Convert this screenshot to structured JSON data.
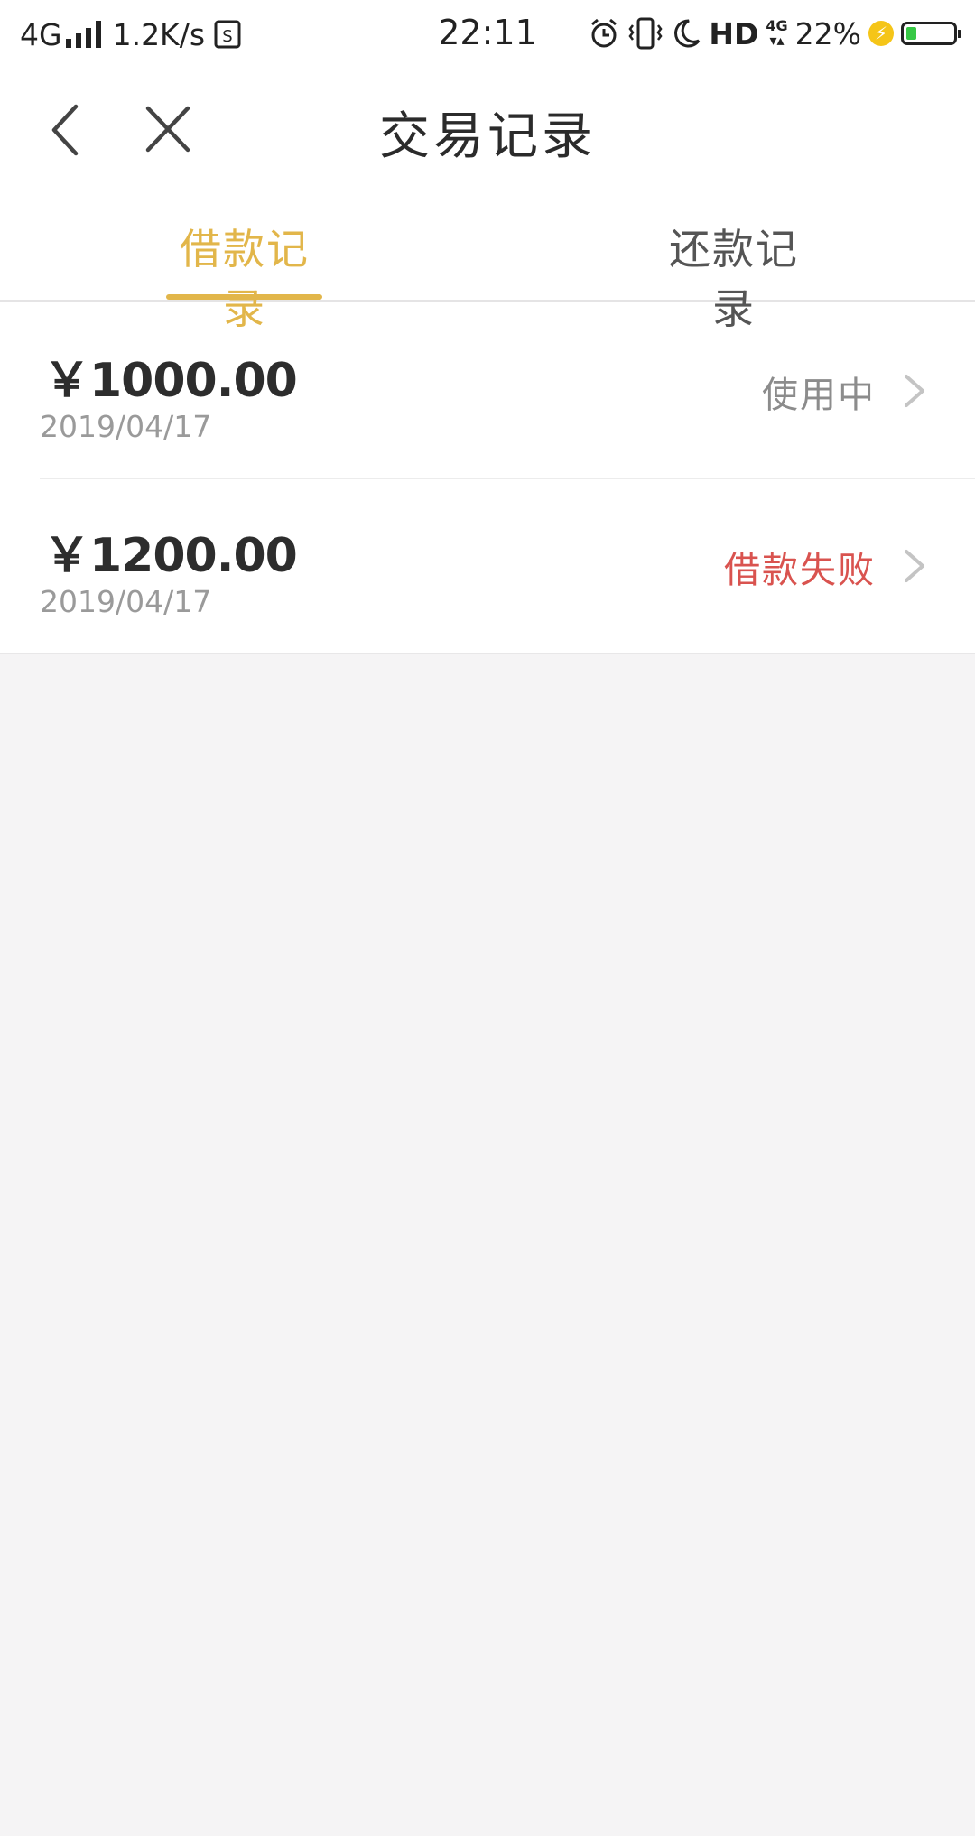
{
  "status_bar": {
    "network": "4G",
    "speed": "1.2K/s",
    "sim_icon": "sim-icon",
    "time": "22:11",
    "alarm_icon": "alarm-icon",
    "vibrate_icon": "vibrate-icon",
    "moon_icon": "moon-icon",
    "hd": "HD",
    "net_4g": "4G",
    "battery_percent": "22%",
    "battery_level": 0.22,
    "battery_color": "#37c845",
    "charging_icon": "charging-bolt-icon"
  },
  "nav": {
    "back_icon": "chevron-left-icon",
    "close_icon": "close-icon",
    "title": "交易记录"
  },
  "tabs": [
    {
      "label": "借款记录",
      "active": true
    },
    {
      "label": "还款记录",
      "active": false
    }
  ],
  "accent_color": "#e2b64a",
  "records": [
    {
      "amount": "￥1000.00",
      "date": "2019/04/17",
      "status": "使用中",
      "status_color": "#8c8c8c"
    },
    {
      "amount": "￥1200.00",
      "date": "2019/04/17",
      "status": "借款失败",
      "status_color": "#d9534f"
    }
  ]
}
